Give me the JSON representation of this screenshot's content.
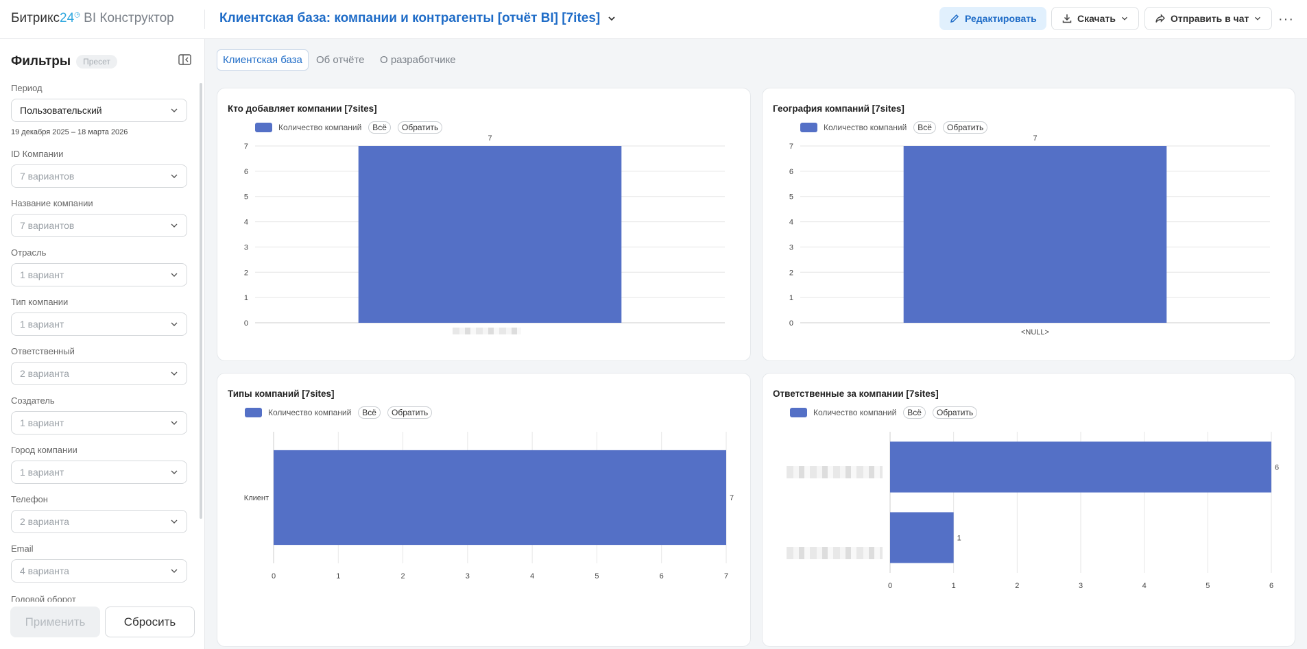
{
  "header": {
    "logo_brand": "Битрикс",
    "logo_num": "24",
    "logo_product": "BI Конструктор",
    "report_title": "Клиентская база: компании и контрагенты [отчёт BI] [7ites]",
    "edit_label": "Редактировать",
    "download_label": "Скачать",
    "send_label": "Отправить в чат",
    "more_label": "···"
  },
  "sidebar": {
    "title": "Фильтры",
    "preset": "Пресет",
    "period": {
      "label": "Период",
      "value": "Пользовательский",
      "range": "19 декабря 2025 – 18 марта 2026"
    },
    "filters": [
      {
        "label": "ID Компании",
        "value": "7 вариантов"
      },
      {
        "label": "Название компании",
        "value": "7 вариантов"
      },
      {
        "label": "Отрасль",
        "value": "1 вариант"
      },
      {
        "label": "Тип компании",
        "value": "1 вариант"
      },
      {
        "label": "Ответственный",
        "value": "2 варианта"
      },
      {
        "label": "Создатель",
        "value": "1 вариант"
      },
      {
        "label": "Город компании",
        "value": "1 вариант"
      },
      {
        "label": "Телефон",
        "value": "2 варианта"
      },
      {
        "label": "Email",
        "value": "4 варианта"
      }
    ],
    "cut_label": "Годовой оборот",
    "apply_label": "Применить",
    "reset_label": "Сбросить"
  },
  "tabs": [
    {
      "label": "Клиентская база",
      "active": true
    },
    {
      "label": "Об отчёте",
      "active": false
    },
    {
      "label": "О разработчике",
      "active": false
    }
  ],
  "legend": {
    "series": "Количество компаний",
    "all": "Всё",
    "invert": "Обратить",
    "color": "#5470c6"
  },
  "chart_data": [
    {
      "type": "bar",
      "title": "Кто добавляет компании [7sites]",
      "categories": [
        ""
      ],
      "series": [
        {
          "name": "Количество компаний",
          "values": [
            7
          ]
        }
      ],
      "ylim": [
        0,
        7
      ],
      "yticks": [
        "0",
        "1",
        "2",
        "3",
        "4",
        "5",
        "6",
        "7"
      ],
      "data_labels": [
        "7"
      ],
      "grid": true,
      "legend": "top-left"
    },
    {
      "type": "bar",
      "title": "География компаний [7sites]",
      "categories": [
        "<NULL>"
      ],
      "series": [
        {
          "name": "Количество компаний",
          "values": [
            7
          ]
        }
      ],
      "ylim": [
        0,
        7
      ],
      "yticks": [
        "0",
        "1",
        "2",
        "3",
        "4",
        "5",
        "6",
        "7"
      ],
      "data_labels": [
        "7"
      ],
      "grid": true,
      "legend": "top-left"
    },
    {
      "type": "bar",
      "orientation": "horizontal",
      "title": "Типы компаний [7sites]",
      "categories": [
        "Клиент"
      ],
      "series": [
        {
          "name": "Количество компаний",
          "values": [
            7
          ]
        }
      ],
      "xlim": [
        0,
        7
      ],
      "xticks": [
        "0",
        "1",
        "2",
        "3",
        "4",
        "5",
        "6",
        "7"
      ],
      "data_labels": [
        "7"
      ],
      "grid": true,
      "legend": "top-left"
    },
    {
      "type": "bar",
      "orientation": "horizontal",
      "title": "Ответственные за компании [7sites]",
      "categories": [
        "",
        ""
      ],
      "series": [
        {
          "name": "Количество компаний",
          "values": [
            6,
            1
          ]
        }
      ],
      "xlim": [
        0,
        6
      ],
      "xticks": [
        "0",
        "1",
        "2",
        "3",
        "4",
        "5",
        "6"
      ],
      "data_labels": [
        "6",
        "1"
      ],
      "grid": true,
      "legend": "top-left"
    }
  ]
}
